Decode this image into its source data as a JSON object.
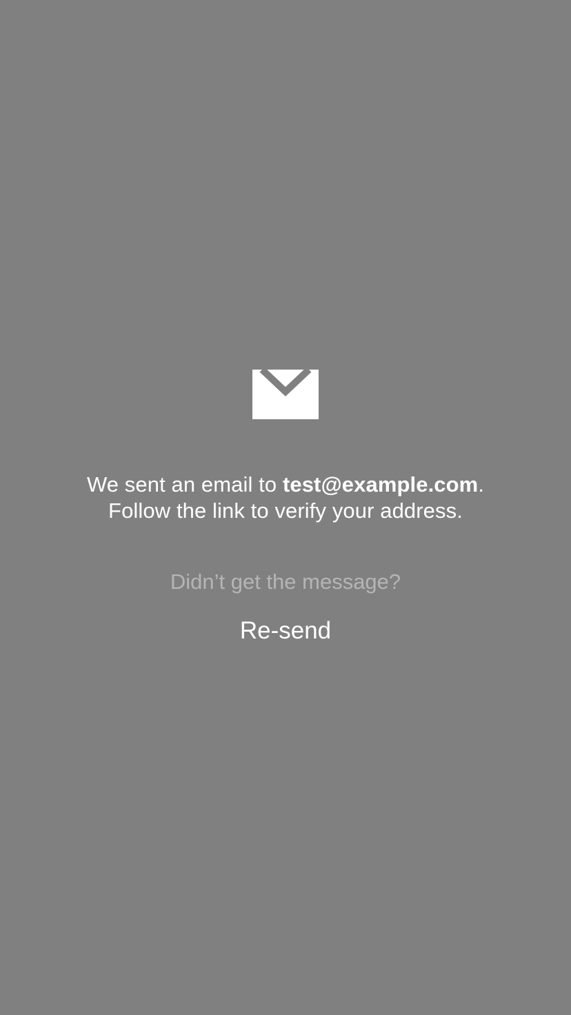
{
  "icon": "mail-envelope-icon",
  "colors": {
    "background": "#808080",
    "text": "#ffffff",
    "muted_text": "#b5b5b5"
  },
  "message": {
    "prefix": "We sent an email to ",
    "email": "test@example.com",
    "suffix": ".",
    "line2": "Follow the link to verify your address."
  },
  "prompt": "Didn’t get the message?",
  "resend_label": "Re-send"
}
